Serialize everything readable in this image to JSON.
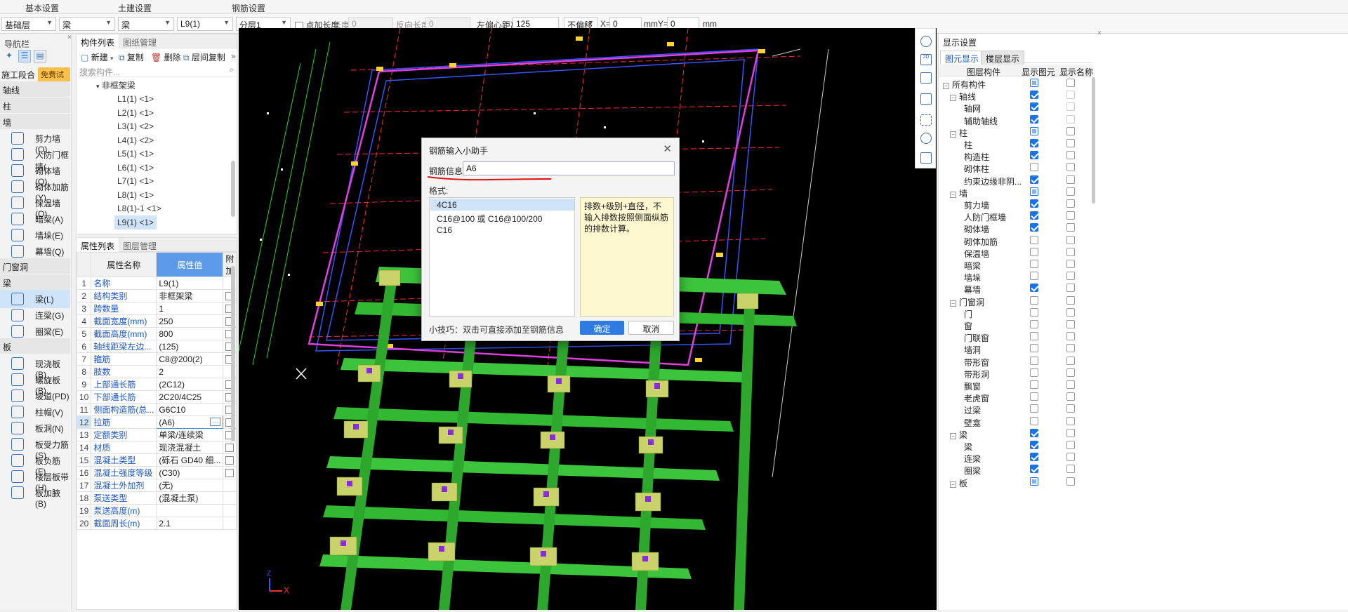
{
  "ribbon": {
    "tabs": [
      "基本设置",
      "土建设置",
      "钢筋设置"
    ]
  },
  "toolbar": {
    "floor": "基础层",
    "category": "梁",
    "type": "梁",
    "component": "L9(1)",
    "layer": "分层1",
    "point_length_label": "点加长度",
    "length_label": "长度:",
    "length_value": "0",
    "reverse_length_label": "反向长度:",
    "reverse_length_value": "0",
    "left_offset_label": "左偏心距离:",
    "left_offset_value": "125",
    "offset_mode": "不偏移",
    "x_label": "X=",
    "x_value": "0",
    "mm1": "mm",
    "y_label": "Y=",
    "y_value": "0",
    "mm2": "mm"
  },
  "nav": {
    "title": "导航栏",
    "stage_label": "施工段合",
    "trial_badge": "免费试用",
    "sections": {
      "axis": "轴线",
      "column": "柱",
      "wall": "墙",
      "opening": "门窗洞",
      "beam": "梁",
      "slab": "板"
    },
    "wall_items": [
      "剪力墙(Q)",
      "人防门框墙(",
      "砌体墙(Q)",
      "砌体加筋(Y)",
      "保温墙(Q)",
      "暗梁(A)",
      "墙垛(E)",
      "幕墙(Q)"
    ],
    "beam_items": [
      "梁(L)",
      "连梁(G)",
      "圈梁(E)"
    ],
    "slab_items": [
      "现浇板(B)",
      "螺旋板(B)",
      "坡道(PD)",
      "柱帽(V)",
      "板洞(N)",
      "板受力筋(S)",
      "板负筋(F)",
      "楼层板带(H)",
      "板加腋(B)"
    ]
  },
  "component_panel": {
    "tabs": [
      "构件列表",
      "图纸管理"
    ],
    "buttons": {
      "new": "新建",
      "copy": "复制",
      "delete": "删除",
      "floor_copy": "层间复制"
    },
    "search_placeholder": "搜索构件...",
    "group": "非框架梁",
    "items": [
      "L1(1) <1>",
      "L2(1) <1>",
      "L3(1) <2>",
      "L4(1) <2>",
      "L5(1) <1>",
      "L6(1) <1>",
      "L7(1) <1>",
      "L8(1) <1>",
      "L8(1)-1 <1>",
      "L9(1) <1>"
    ]
  },
  "property_panel": {
    "tabs": [
      "属性列表",
      "图层管理"
    ],
    "headers": [
      "属性名称",
      "属性值",
      "附加"
    ],
    "rows": [
      {
        "n": "1",
        "name": "名称",
        "value": "L9(1)",
        "cb": false
      },
      {
        "n": "2",
        "name": "结构类别",
        "value": "非框架梁",
        "cb": true
      },
      {
        "n": "3",
        "name": "跨数量",
        "value": "1",
        "cb": true
      },
      {
        "n": "4",
        "name": "截面宽度(mm)",
        "value": "250",
        "cb": true
      },
      {
        "n": "5",
        "name": "截面高度(mm)",
        "value": "800",
        "cb": true
      },
      {
        "n": "6",
        "name": "轴线距梁左边...",
        "value": "(125)",
        "cb": true
      },
      {
        "n": "7",
        "name": "箍筋",
        "value": "C8@200(2)",
        "cb": true
      },
      {
        "n": "8",
        "name": "肢数",
        "value": "2",
        "cb": false
      },
      {
        "n": "9",
        "name": "上部通长筋",
        "value": "(2C12)",
        "cb": true
      },
      {
        "n": "10",
        "name": "下部通长筋",
        "value": "2C20/4C25",
        "cb": true
      },
      {
        "n": "11",
        "name": "侧面构造筋(总...",
        "value": "G6C10",
        "cb": true
      },
      {
        "n": "12",
        "name": "拉筋",
        "value": "(A6)",
        "cb": true
      },
      {
        "n": "13",
        "name": "定额类别",
        "value": "单梁/连续梁",
        "cb": true
      },
      {
        "n": "14",
        "name": "材质",
        "value": "现浇混凝土",
        "cb": true
      },
      {
        "n": "15",
        "name": "混凝土类型",
        "value": "(砾石 GD40 细...",
        "cb": true
      },
      {
        "n": "16",
        "name": "混凝土强度等级",
        "value": "(C30)",
        "cb": true
      },
      {
        "n": "17",
        "name": "混凝土外加剂",
        "value": "(无)",
        "cb": false
      },
      {
        "n": "18",
        "name": "泵送类型",
        "value": "(混凝土泵)",
        "cb": false
      },
      {
        "n": "19",
        "name": "泵送高度(m)",
        "value": "",
        "cb": false
      },
      {
        "n": "20",
        "name": "截面周长(m)",
        "value": "2.1",
        "cb": false
      }
    ]
  },
  "dialog": {
    "title": "钢筋输入小助手",
    "info_label": "钢筋信息:",
    "info_value": "A6",
    "format_label": "格式:",
    "formats": [
      "4C16",
      "C16@100 或 C16@100/200",
      "C16"
    ],
    "description": "排数+级别+直径，不输入排数按照侧面纵筋的排数计算。",
    "tip": "小技巧：双击可直接添加至钢筋信息",
    "ok": "确定",
    "cancel": "取消"
  },
  "display_panel": {
    "title": "显示设置",
    "tabs": [
      "图元显示",
      "楼层显示"
    ],
    "headers": [
      "图层构件",
      "显示图元",
      "显示名称"
    ],
    "rows": [
      {
        "label": "所有构件",
        "level": 0,
        "exp": "-",
        "c1": "part",
        "c2": "off"
      },
      {
        "label": "轴线",
        "level": 1,
        "exp": "-",
        "c1": "on",
        "c2": "dim"
      },
      {
        "label": "轴网",
        "level": 2,
        "exp": "",
        "c1": "on",
        "c2": "dim"
      },
      {
        "label": "辅助轴线",
        "level": 2,
        "exp": "",
        "c1": "on",
        "c2": "dim"
      },
      {
        "label": "柱",
        "level": 1,
        "exp": "-",
        "c1": "part",
        "c2": "off"
      },
      {
        "label": "柱",
        "level": 2,
        "exp": "",
        "c1": "on",
        "c2": "off"
      },
      {
        "label": "构造柱",
        "level": 2,
        "exp": "",
        "c1": "on",
        "c2": "off"
      },
      {
        "label": "砌体柱",
        "level": 2,
        "exp": "",
        "c1": "off",
        "c2": "off"
      },
      {
        "label": "约束边缘非阴...",
        "level": 2,
        "exp": "",
        "c1": "on",
        "c2": "off"
      },
      {
        "label": "墙",
        "level": 1,
        "exp": "-",
        "c1": "part",
        "c2": "off"
      },
      {
        "label": "剪力墙",
        "level": 2,
        "exp": "",
        "c1": "on",
        "c2": "off"
      },
      {
        "label": "人防门框墙",
        "level": 2,
        "exp": "",
        "c1": "on",
        "c2": "off"
      },
      {
        "label": "砌体墙",
        "level": 2,
        "exp": "",
        "c1": "on",
        "c2": "off"
      },
      {
        "label": "砌体加筋",
        "level": 2,
        "exp": "",
        "c1": "off",
        "c2": "off"
      },
      {
        "label": "保温墙",
        "level": 2,
        "exp": "",
        "c1": "off",
        "c2": "off"
      },
      {
        "label": "暗梁",
        "level": 2,
        "exp": "",
        "c1": "off",
        "c2": "off"
      },
      {
        "label": "墙垛",
        "level": 2,
        "exp": "",
        "c1": "off",
        "c2": "off"
      },
      {
        "label": "幕墙",
        "level": 2,
        "exp": "",
        "c1": "on",
        "c2": "off"
      },
      {
        "label": "门窗洞",
        "level": 1,
        "exp": "-",
        "c1": "off",
        "c2": "off"
      },
      {
        "label": "门",
        "level": 2,
        "exp": "",
        "c1": "off",
        "c2": "off"
      },
      {
        "label": "窗",
        "level": 2,
        "exp": "",
        "c1": "off",
        "c2": "off"
      },
      {
        "label": "门联窗",
        "level": 2,
        "exp": "",
        "c1": "off",
        "c2": "off"
      },
      {
        "label": "墙洞",
        "level": 2,
        "exp": "",
        "c1": "off",
        "c2": "off"
      },
      {
        "label": "带形窗",
        "level": 2,
        "exp": "",
        "c1": "off",
        "c2": "off"
      },
      {
        "label": "带形洞",
        "level": 2,
        "exp": "",
        "c1": "off",
        "c2": "off"
      },
      {
        "label": "飘窗",
        "level": 2,
        "exp": "",
        "c1": "off",
        "c2": "off"
      },
      {
        "label": "老虎窗",
        "level": 2,
        "exp": "",
        "c1": "off",
        "c2": "off"
      },
      {
        "label": "过梁",
        "level": 2,
        "exp": "",
        "c1": "off",
        "c2": "off"
      },
      {
        "label": "壁龛",
        "level": 2,
        "exp": "",
        "c1": "off",
        "c2": "off"
      },
      {
        "label": "梁",
        "level": 1,
        "exp": "-",
        "c1": "on",
        "c2": "off"
      },
      {
        "label": "梁",
        "level": 2,
        "exp": "",
        "c1": "on",
        "c2": "off"
      },
      {
        "label": "连梁",
        "level": 2,
        "exp": "",
        "c1": "on",
        "c2": "off"
      },
      {
        "label": "圈梁",
        "level": 2,
        "exp": "",
        "c1": "on",
        "c2": "off"
      },
      {
        "label": "板",
        "level": 1,
        "exp": "-",
        "c1": "part",
        "c2": "off"
      }
    ]
  },
  "canvas": {
    "axis_x": "X",
    "axis_y": "Z"
  }
}
